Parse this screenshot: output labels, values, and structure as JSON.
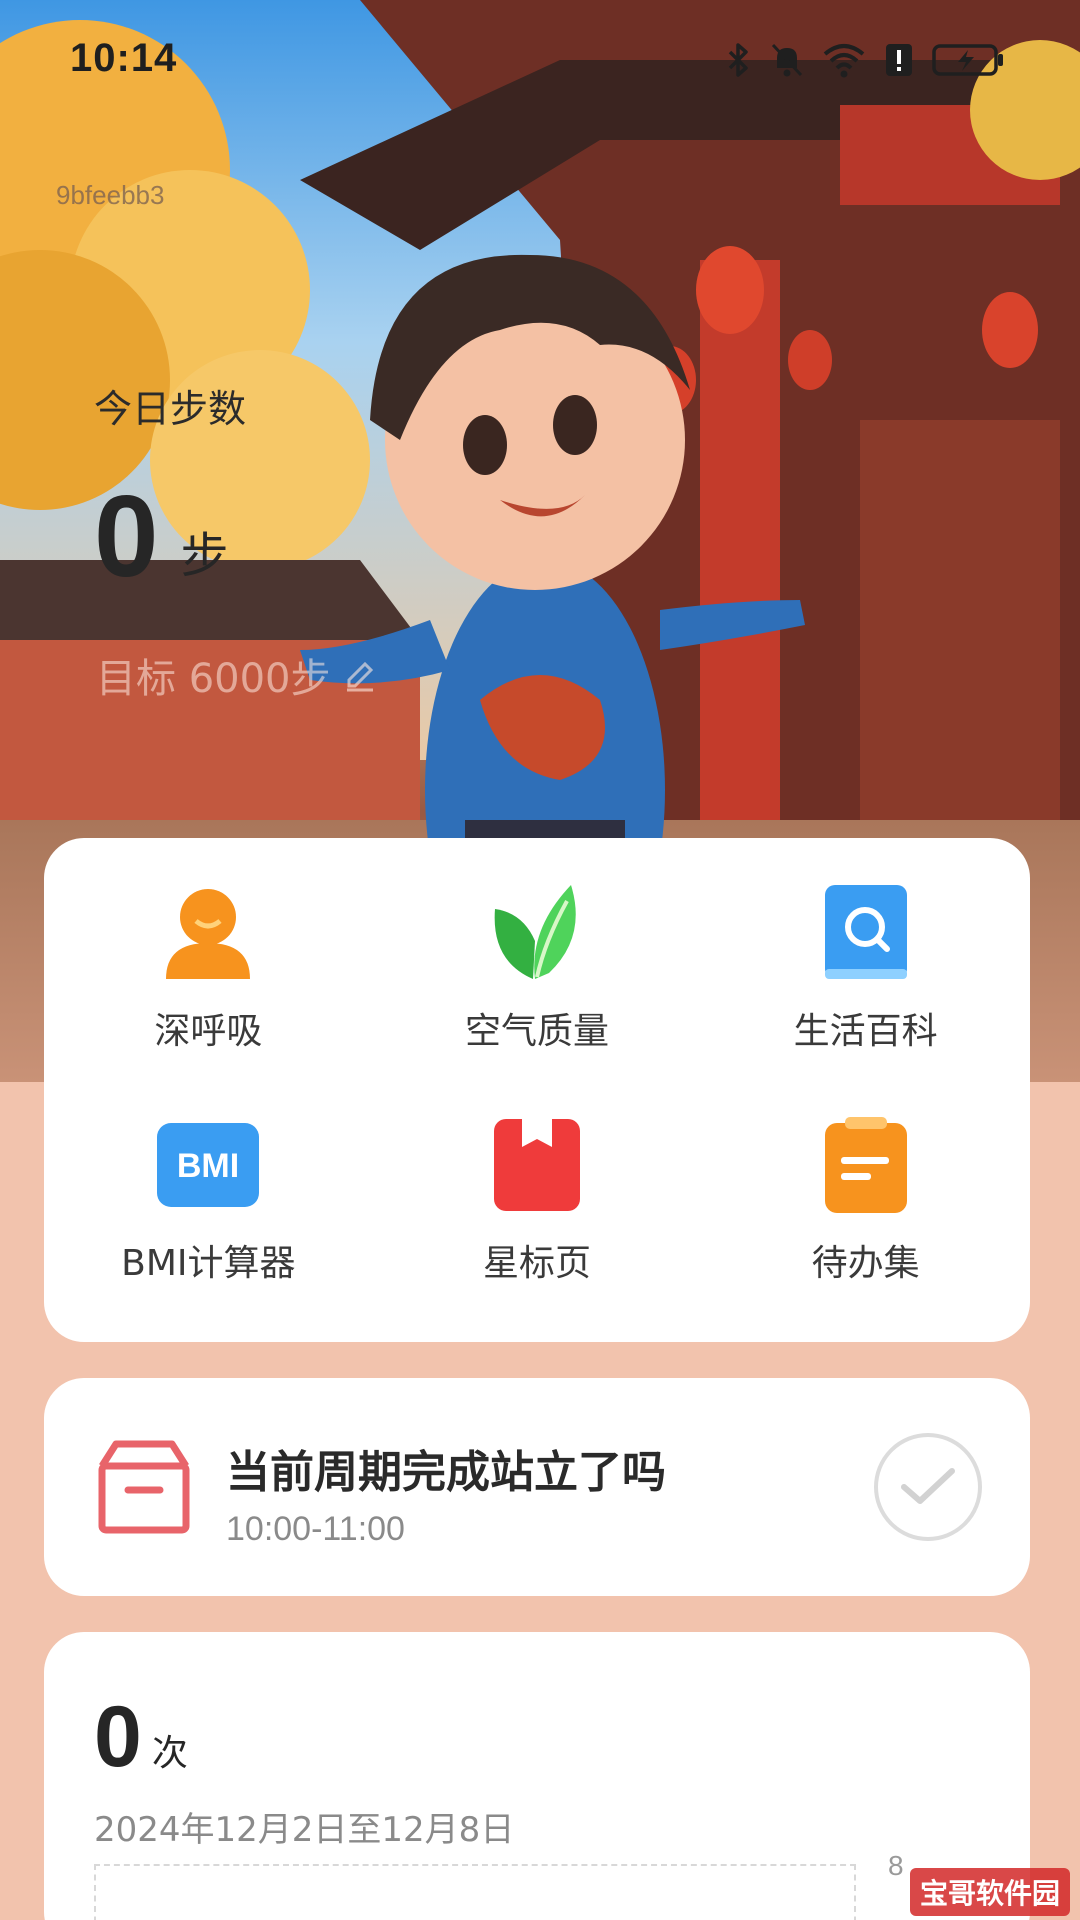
{
  "status_bar": {
    "time": "10:14",
    "icons": [
      "bluetooth-icon",
      "mute-icon",
      "wifi-icon",
      "alert-icon",
      "battery-charging-icon"
    ]
  },
  "device_code": "9bfeebb3",
  "steps": {
    "label": "今日步数",
    "value": "0",
    "unit": "步",
    "goal": "目标 6000步"
  },
  "shortcuts": [
    {
      "label": "深呼吸",
      "icon": "person-icon",
      "color": "#f7931e"
    },
    {
      "label": "空气质量",
      "icon": "leaf-icon",
      "color": "#3cbf4a"
    },
    {
      "label": "生活百科",
      "icon": "book-search-icon",
      "color": "#3a9df2"
    },
    {
      "label": "BMI计算器",
      "icon": "bmi-icon",
      "color": "#3a9df2",
      "icon_text": "BMI"
    },
    {
      "label": "星标页",
      "icon": "bookmark-icon",
      "color": "#ef3b3b"
    },
    {
      "label": "待办集",
      "icon": "todo-icon",
      "color": "#f7931e"
    }
  ],
  "task": {
    "title": "当前周期完成站立了吗",
    "time": "10:00-11:00"
  },
  "stats": {
    "count": "0",
    "unit": "次",
    "range": "2024年12月2日至12月8日",
    "axis_max": "8"
  },
  "watermark": "宝哥软件园"
}
